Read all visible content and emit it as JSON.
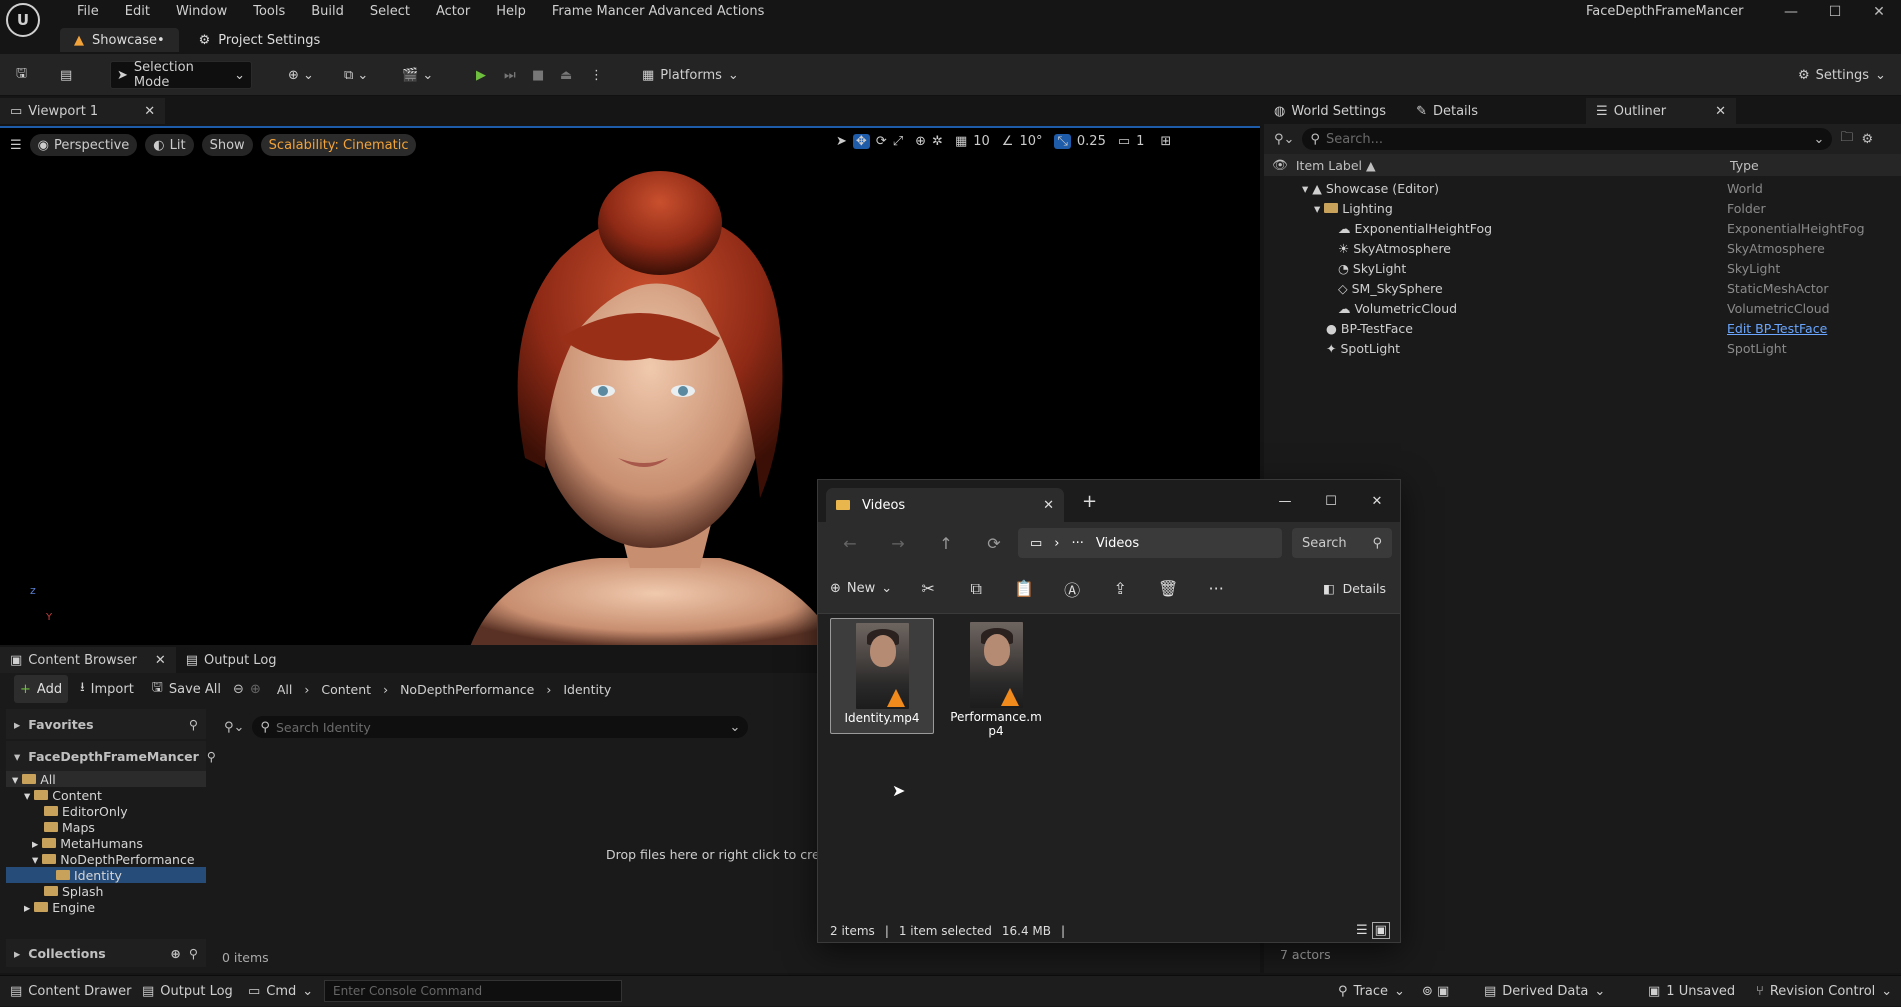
{
  "menubar": {
    "items": [
      "File",
      "Edit",
      "Window",
      "Tools",
      "Build",
      "Select",
      "Actor",
      "Help",
      "Frame Mancer Advanced Actions"
    ],
    "app_name": "FaceDepthFrameMancer"
  },
  "doc_tabs": [
    {
      "label": "Showcase•"
    },
    {
      "label": "Project Settings"
    }
  ],
  "toolbar": {
    "selection_mode": "Selection Mode",
    "platforms": "Platforms",
    "settings": "Settings"
  },
  "viewport": {
    "tab_label": "Viewport 1",
    "perspective": "Perspective",
    "lit": "Lit",
    "show": "Show",
    "scalability": "Scalability: Cinematic",
    "grid": "10",
    "angle": "10°",
    "scale": "0.25",
    "camera": "1",
    "axis_z": "z",
    "axis_y": "Y"
  },
  "right_tabs": [
    {
      "label": "World Settings"
    },
    {
      "label": "Details"
    },
    {
      "label": "Outliner"
    }
  ],
  "outliner": {
    "search_placeholder": "Search...",
    "col_label": "Item Label ▲",
    "col_type": "Type",
    "rows": [
      {
        "label": "Showcase (Editor)",
        "type": "World"
      },
      {
        "label": "Lighting",
        "type": "Folder"
      },
      {
        "label": "ExponentialHeightFog",
        "type": "ExponentialHeightFog"
      },
      {
        "label": "SkyAtmosphere",
        "type": "SkyAtmosphere"
      },
      {
        "label": "SkyLight",
        "type": "SkyLight"
      },
      {
        "label": "SM_SkySphere",
        "type": "StaticMeshActor"
      },
      {
        "label": "VolumetricCloud",
        "type": "VolumetricCloud"
      },
      {
        "label": "BP-TestFace",
        "type": "Edit BP-TestFace"
      },
      {
        "label": "SpotLight",
        "type": "SpotLight"
      }
    ],
    "actor_count": "7 actors"
  },
  "content_browser": {
    "tab": "Content Browser",
    "output_tab": "Output Log",
    "add": "Add",
    "import": "Import",
    "save_all": "Save All",
    "breadcrumb": [
      "All",
      "Content",
      "NoDepthPerformance",
      "Identity"
    ],
    "favorites": "Favorites",
    "project": "FaceDepthFrameMancer",
    "search_placeholder": "Search Identity",
    "tree": [
      "All",
      "Content",
      "EditorOnly",
      "Maps",
      "MetaHumans",
      "NoDepthPerformance",
      "Identity",
      "Splash",
      "Engine"
    ],
    "collections": "Collections",
    "drop_hint": "Drop files here or right click to create",
    "item_count": "0 items"
  },
  "explorer": {
    "tab_title": "Videos",
    "address": "Videos",
    "search": "Search",
    "new": "New",
    "details": "Details",
    "files": [
      {
        "name": "Identity.mp4"
      },
      {
        "name": "Performance.mp4"
      }
    ],
    "status_items": "2 items",
    "status_selected": "1 item selected",
    "status_size": "16.4 MB"
  },
  "statusbar": {
    "content_drawer": "Content Drawer",
    "output_log": "Output Log",
    "cmd": "Cmd",
    "console_placeholder": "Enter Console Command",
    "trace": "Trace",
    "derived_data": "Derived Data",
    "unsaved": "1 Unsaved",
    "revision": "Revision Control"
  }
}
